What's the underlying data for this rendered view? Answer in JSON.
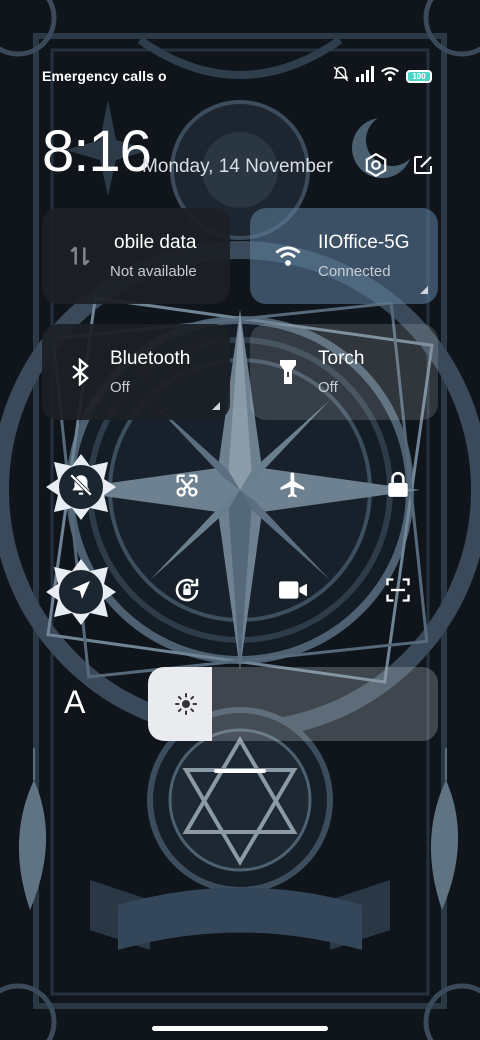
{
  "status_bar": {
    "carrier_text": "Emergency calls o",
    "battery_level": "100",
    "icons": [
      "mute-icon",
      "signal-icon",
      "wifi-icon",
      "battery-icon"
    ]
  },
  "header": {
    "time": "8:16",
    "date": "Monday, 14 November",
    "icons": [
      "settings-icon",
      "edit-icon"
    ]
  },
  "tiles": [
    {
      "title": "obile data",
      "subtitle": "Not available",
      "icon": "mobile-data-icon"
    },
    {
      "title": "IIOffice-5G",
      "subtitle": "Connected",
      "icon": "wifi-icon"
    },
    {
      "title": "Bluetooth",
      "subtitle": "Off",
      "icon": "bluetooth-icon"
    },
    {
      "title": "Torch",
      "subtitle": "Off",
      "icon": "torch-icon"
    }
  ],
  "toggles": [
    {
      "name": "silent-mode",
      "icon": "bell-off-icon",
      "active": true
    },
    {
      "name": "screenshot",
      "icon": "scissors-icon",
      "active": false
    },
    {
      "name": "airplane-mode",
      "icon": "airplane-icon",
      "active": false
    },
    {
      "name": "lock-screen",
      "icon": "lock-icon",
      "active": false
    },
    {
      "name": "location",
      "icon": "location-arrow-icon",
      "active": true
    },
    {
      "name": "rotation-lock",
      "icon": "rotation-lock-icon",
      "active": false
    },
    {
      "name": "screen-recorder",
      "icon": "video-camera-icon",
      "active": false
    },
    {
      "name": "scanner",
      "icon": "scan-icon",
      "active": false
    }
  ],
  "brightness": {
    "level": 0.22,
    "auto_label": "A",
    "icon": "sun-icon"
  },
  "colors": {
    "accent": "#4fd1c5",
    "tile_dark": "#1c2026",
    "tile_active": "#5f82a0",
    "wallpaper_bg": "#10151c",
    "wallpaper_line": "#5e7384"
  }
}
